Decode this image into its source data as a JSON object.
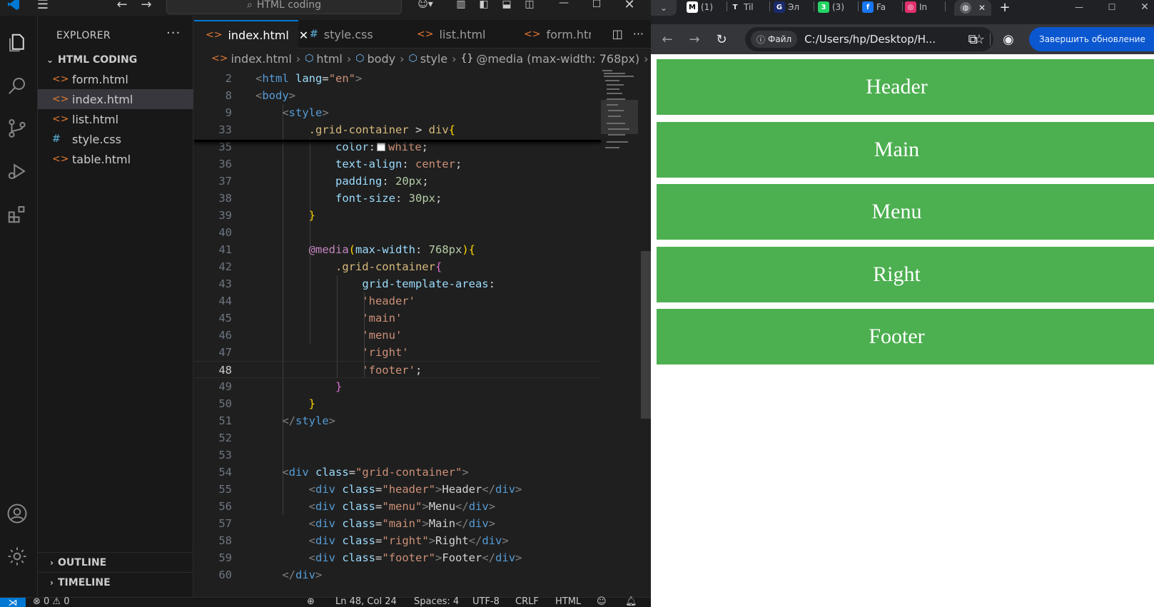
{
  "vscode": {
    "title_search": "HTML coding",
    "sidebar": {
      "header": "EXPLORER",
      "folder": "HTML CODING",
      "files": [
        {
          "name": "form.html",
          "type": "html"
        },
        {
          "name": "index.html",
          "type": "html",
          "active": true
        },
        {
          "name": "list.html",
          "type": "html"
        },
        {
          "name": "style.css",
          "type": "css"
        },
        {
          "name": "table.html",
          "type": "html"
        }
      ],
      "outline": "OUTLINE",
      "timeline": "TIMELINE"
    },
    "tabs": [
      {
        "label": "index.html",
        "icon": "<>"
      },
      {
        "label": "style.css",
        "icon": "#"
      },
      {
        "label": "list.html",
        "icon": "<>"
      },
      {
        "label": "form.htr",
        "icon": "<>"
      }
    ],
    "breadcrumb": [
      "index.html",
      "html",
      "body",
      "style",
      "@media (max-width: 768px)"
    ],
    "code_lines": [
      {
        "n": "2",
        "html": "<span class='t-tag'>&lt;</span><span class='t-name'>html</span> <span class='t-attr'>lang</span><span class='t-txt'>=</span><span class='t-str'>\"en\"</span><span class='t-tag'>&gt;</span>"
      },
      {
        "n": "8",
        "html": "<span class='t-tag'>&lt;</span><span class='t-name'>body</span><span class='t-tag'>&gt;</span>"
      },
      {
        "n": "9",
        "html": "    <span class='t-tag'>&lt;</span><span class='t-name'>style</span><span class='t-tag'>&gt;</span>"
      },
      {
        "n": "33",
        "html": "        <span class='t-sel'>.grid-container</span> <span class='t-txt'>&gt;</span> <span class='t-sel'>div</span><span class='t-b1'>{</span>"
      },
      {
        "n": "35",
        "html": "            <span class='t-prop'>color</span><span class='t-txt'>:</span><span class='swatch'></span><span class='t-val'>white</span><span class='t-txt'>;</span>"
      },
      {
        "n": "36",
        "html": "            <span class='t-prop'>text-align</span><span class='t-txt'>: </span><span class='t-val'>center</span><span class='t-txt'>;</span>"
      },
      {
        "n": "37",
        "html": "            <span class='t-prop'>padding</span><span class='t-txt'>: </span><span class='t-num'>20px</span><span class='t-txt'>;</span>"
      },
      {
        "n": "38",
        "html": "            <span class='t-prop'>font-size</span><span class='t-txt'>: </span><span class='t-num'>30px</span><span class='t-txt'>;</span>"
      },
      {
        "n": "39",
        "html": "        <span class='t-b1'>}</span>"
      },
      {
        "n": "40",
        "html": ""
      },
      {
        "n": "41",
        "html": "        <span class='t-at'>@media</span><span class='t-b1'>(</span><span class='t-prop'>max-width</span><span class='t-txt'>: </span><span class='t-num'>768px</span><span class='t-b1'>){</span>"
      },
      {
        "n": "42",
        "html": "            <span class='t-sel'>.grid-container</span><span class='t-b2'>{</span>"
      },
      {
        "n": "43",
        "html": "                <span class='t-prop'>grid-template-areas</span><span class='t-txt'>:</span>"
      },
      {
        "n": "44",
        "html": "                <span class='t-val'>'header'</span>"
      },
      {
        "n": "45",
        "html": "                <span class='t-val'>'main'</span>"
      },
      {
        "n": "46",
        "html": "                <span class='t-val'>'menu'</span>"
      },
      {
        "n": "47",
        "html": "                <span class='t-val'>'right'</span>"
      },
      {
        "n": "48",
        "html": "                <span class='t-val'>'footer'</span><span class='t-txt'>;</span>",
        "current": true
      },
      {
        "n": "49",
        "html": "            <span class='t-b2'>}</span>"
      },
      {
        "n": "50",
        "html": "        <span class='t-b1'>}</span>"
      },
      {
        "n": "51",
        "html": "    <span class='t-tag'>&lt;/</span><span class='t-name'>style</span><span class='t-tag'>&gt;</span>"
      },
      {
        "n": "52",
        "html": ""
      },
      {
        "n": "53",
        "html": ""
      },
      {
        "n": "54",
        "html": "    <span class='t-tag'>&lt;</span><span class='t-name'>div</span> <span class='t-attr'>class</span><span class='t-txt'>=</span><span class='t-str'>\"grid-container\"</span><span class='t-tag'>&gt;</span>"
      },
      {
        "n": "55",
        "html": "        <span class='t-tag'>&lt;</span><span class='t-name'>div</span> <span class='t-attr'>class</span><span class='t-txt'>=</span><span class='t-str'>\"header\"</span><span class='t-tag'>&gt;</span><span class='t-txt'>Header</span><span class='t-tag'>&lt;/</span><span class='t-name'>div</span><span class='t-tag'>&gt;</span>"
      },
      {
        "n": "56",
        "html": "        <span class='t-tag'>&lt;</span><span class='t-name'>div</span> <span class='t-attr'>class</span><span class='t-txt'>=</span><span class='t-str'>\"menu\"</span><span class='t-tag'>&gt;</span><span class='t-txt'>Menu</span><span class='t-tag'>&lt;/</span><span class='t-name'>div</span><span class='t-tag'>&gt;</span>"
      },
      {
        "n": "57",
        "html": "        <span class='t-tag'>&lt;</span><span class='t-name'>div</span> <span class='t-attr'>class</span><span class='t-txt'>=</span><span class='t-str'>\"main\"</span><span class='t-tag'>&gt;</span><span class='t-txt'>Main</span><span class='t-tag'>&lt;/</span><span class='t-name'>div</span><span class='t-tag'>&gt;</span>"
      },
      {
        "n": "58",
        "html": "        <span class='t-tag'>&lt;</span><span class='t-name'>div</span> <span class='t-attr'>class</span><span class='t-txt'>=</span><span class='t-str'>\"right\"</span><span class='t-tag'>&gt;</span><span class='t-txt'>Right</span><span class='t-tag'>&lt;/</span><span class='t-name'>div</span><span class='t-tag'>&gt;</span>"
      },
      {
        "n": "59",
        "html": "        <span class='t-tag'>&lt;</span><span class='t-name'>div</span> <span class='t-attr'>class</span><span class='t-txt'>=</span><span class='t-str'>\"footer\"</span><span class='t-tag'>&gt;</span><span class='t-txt'>Footer</span><span class='t-tag'>&lt;/</span><span class='t-name'>div</span><span class='t-tag'>&gt;</span>"
      },
      {
        "n": "60",
        "html": "    <span class='t-tag'>&lt;/</span><span class='t-name'>div</span><span class='t-tag'>&gt;</span>"
      }
    ],
    "status": {
      "problems": "⊗ 0 ⚠ 0",
      "position": "Ln 48, Col 24",
      "spaces": "Spaces: 4",
      "encoding": "UTF-8",
      "eol": "CRLF",
      "language": "HTML"
    }
  },
  "browser": {
    "tabs": [
      {
        "label": "(1)",
        "fav": "M",
        "color": "#ffffff",
        "fg": "#000000"
      },
      {
        "label": "Til",
        "fav": "T",
        "color": "#202124",
        "fg": "#e8eaed"
      },
      {
        "label": "Эл",
        "fav": "G",
        "color": "#1a2a6c",
        "fg": "#ffffff"
      },
      {
        "label": "(3)",
        "fav": "3",
        "color": "#25d366",
        "fg": "#ffffff"
      },
      {
        "label": "Fa",
        "fav": "f",
        "color": "#1877f2",
        "fg": "#ffffff"
      },
      {
        "label": "In",
        "fav": "◎",
        "color": "#e1306c",
        "fg": "#ffffff"
      }
    ],
    "url_chip": "Файл",
    "url": "C:/Users/hp/Desktop/H...",
    "update_button": "Завершить обновление",
    "page_items": [
      "Header",
      "Main",
      "Menu",
      "Right",
      "Footer"
    ],
    "accent": "#4caf50"
  }
}
